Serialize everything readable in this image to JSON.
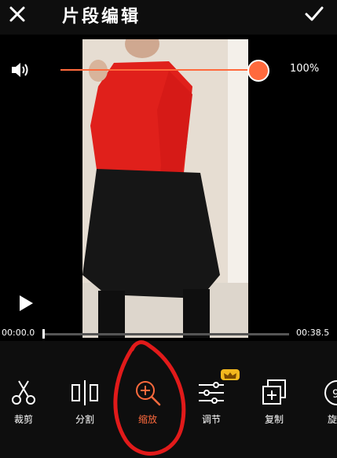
{
  "header": {
    "title": "片段编辑",
    "close_icon": "close-icon",
    "confirm_icon": "check-icon"
  },
  "volume": {
    "icon": "speaker-icon",
    "level_fraction": 1.0,
    "level_label": "100%"
  },
  "player": {
    "play_icon": "play-icon",
    "current_time": "00:00.0",
    "total_time": "00:38.5"
  },
  "tools": [
    {
      "id": "crop",
      "label": "裁剪",
      "icon": "scissors-icon"
    },
    {
      "id": "split",
      "label": "分割",
      "icon": "split-icon"
    },
    {
      "id": "zoom",
      "label": "缩放",
      "icon": "zoom-in-icon",
      "active": true
    },
    {
      "id": "adjust",
      "label": "调节",
      "icon": "sliders-icon",
      "badge_icon": "crown-icon"
    },
    {
      "id": "copy",
      "label": "复制",
      "icon": "copy-plus-icon"
    },
    {
      "id": "rotate",
      "label": "旋",
      "icon": "rotate-icon"
    }
  ],
  "colors": {
    "accent": "#ff6a3d",
    "background": "#0e0e0e",
    "crown": "#f2b81e"
  }
}
